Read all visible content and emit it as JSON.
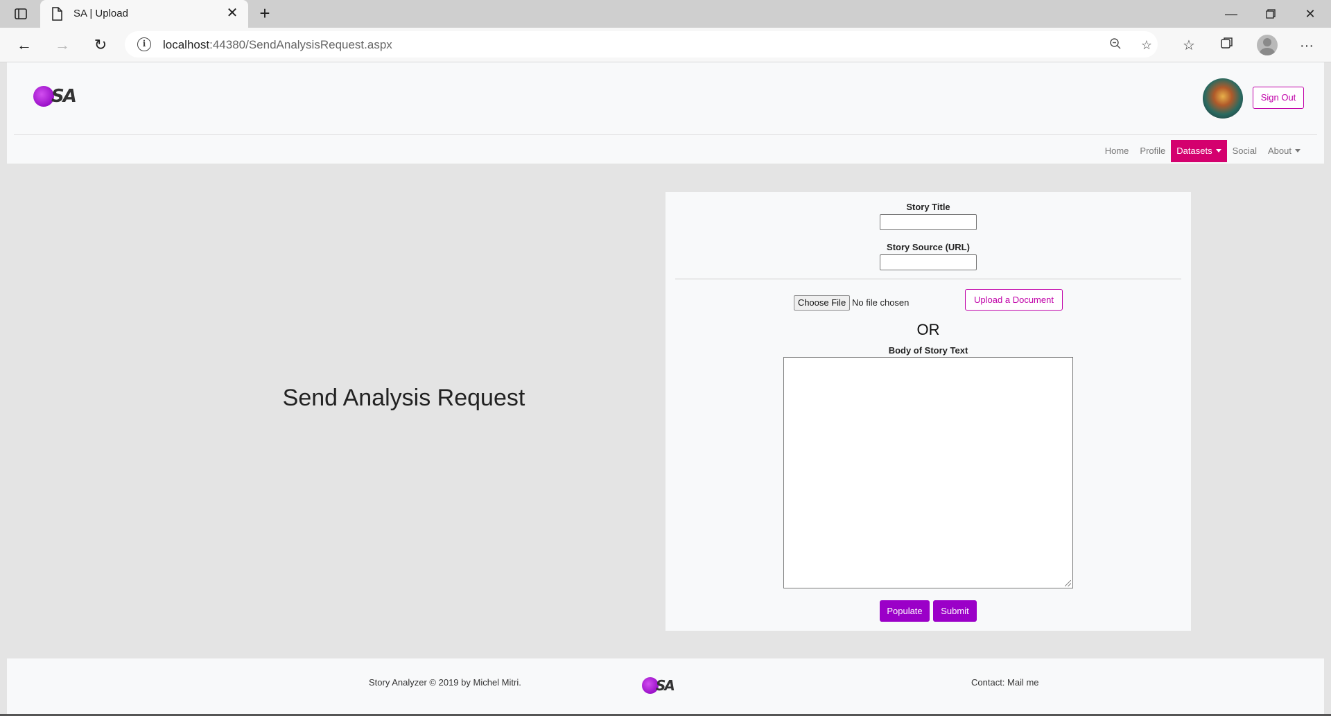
{
  "browser": {
    "tab_title": "SA | Upload",
    "url_host": "localhost",
    "url_path": ":44380/SendAnalysisRequest.aspx"
  },
  "header": {
    "logo_text": "SA",
    "sign_out_label": "Sign Out"
  },
  "nav": {
    "home": "Home",
    "profile": "Profile",
    "datasets": "Datasets",
    "social": "Social",
    "about": "About"
  },
  "page": {
    "title": "Send Analysis Request"
  },
  "form": {
    "story_title_label": "Story Title",
    "story_title_value": "",
    "story_source_label": "Story Source (URL)",
    "story_source_value": "",
    "choose_file_label": "Choose File",
    "no_file_text": "No file chosen",
    "upload_label": "Upload a Document",
    "or_text": "OR",
    "body_label": "Body of Story Text",
    "body_value": "",
    "populate_label": "Populate",
    "submit_label": "Submit"
  },
  "footer": {
    "copyright": "Story Analyzer © 2019 by Michel Mitri.",
    "logo_text": "SA",
    "contact": "Contact: Mail me"
  },
  "colors": {
    "accent_magenta": "#c000a8",
    "active_nav": "#d4006e",
    "button_purple": "#9b00c8"
  },
  "icons": {
    "tab_toggle": "tab-actions-icon",
    "page_icon": "page-icon",
    "back": "back-arrow-icon",
    "forward": "forward-arrow-icon",
    "refresh": "refresh-icon",
    "info": "info-icon",
    "zoom": "zoom-out-icon",
    "favorite_add": "add-favorite-icon",
    "favorites": "favorites-icon",
    "collections": "collections-icon",
    "profile": "profile-icon",
    "more": "more-icon"
  }
}
